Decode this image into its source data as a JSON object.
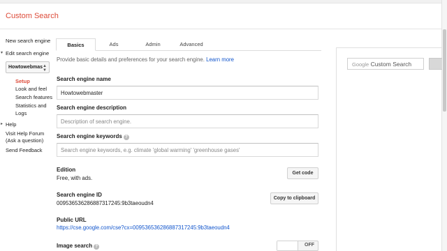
{
  "app": {
    "title": "Custom Search"
  },
  "sidebar": {
    "new_engine": "New search engine",
    "edit_engine": "Edit search engine",
    "selected_engine": "Howtowebmas",
    "sub_items": [
      "Setup",
      "Look and feel",
      "Search features",
      "Statistics and",
      "Logs"
    ],
    "help": "Help",
    "help_forum_1": "Visit Help Forum",
    "help_forum_2": "(Ask a question)",
    "feedback": "Send Feedback"
  },
  "tabs": [
    "Basics",
    "Ads",
    "Admin",
    "Advanced"
  ],
  "active_tab": "Basics",
  "form": {
    "intro": "Provide basic details and preferences for your search engine.",
    "learn_more": "Learn more",
    "name_label": "Search engine name",
    "name_value": "Howtowebmaster",
    "description_label": "Search engine description",
    "description_placeholder": "Description of search engine.",
    "keywords_label": "Search engine keywords",
    "keywords_placeholder": "Search engine keywords, e.g. climate 'global warming' 'greenhouse gases'",
    "edition_label": "Edition",
    "edition_value": "Free, with ads.",
    "get_code": "Get code",
    "id_label": "Search engine ID",
    "id_value": "009536536286887317245:9b3taeoudn4",
    "copy_clipboard": "Copy to clipboard",
    "url_label": "Public URL",
    "url_value": "https://cse.google.com/cse?cx=009536536286887317245:9b3taeoudn4",
    "image_search_label": "Image search",
    "image_search_state": "OFF"
  },
  "preview": {
    "google": "Google",
    "custom_search": "Custom Search"
  }
}
